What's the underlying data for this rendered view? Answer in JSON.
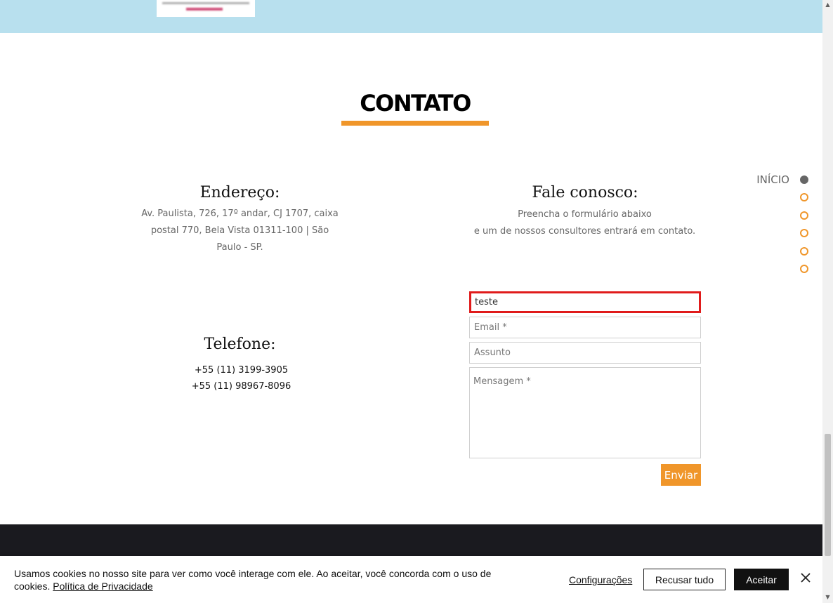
{
  "section": {
    "title": "CONTATO"
  },
  "address": {
    "heading": "Endereço:",
    "text": "Av. Paulista, 726, 17º andar, CJ 1707, caixa postal 770, Bela Vista 01311-100 | São Paulo - SP."
  },
  "phone": {
    "heading": "Telefone:",
    "numbers": [
      "+55 (11) 3199-3905",
      "+55 (11) 98967-8096"
    ]
  },
  "contact": {
    "heading": "Fale conosco:",
    "line1": "Preencha o formulário abaixo",
    "line2": "e um de nossos consultores entrará em contato."
  },
  "form": {
    "name_value": "teste",
    "email_placeholder": "Email *",
    "subject_placeholder": "Assunto",
    "message_placeholder": "Mensagem *",
    "submit_label": "Enviar"
  },
  "side_nav": {
    "active_label": "INÍCIO",
    "dot_count": 6,
    "active_index": 0
  },
  "cookie_banner": {
    "text": "Usamos cookies no nosso site para ver como você interage com ele. Ao aceitar, você concorda com o uso de cookies.",
    "policy_link": "Política de Privacidade",
    "settings_label": "Configurações",
    "reject_label": "Recusar tudo",
    "accept_label": "Aceitar",
    "close_icon": "close-icon"
  },
  "colors": {
    "accent": "#f0962a",
    "top_band": "#b8e0ee",
    "footer": "#1a1a1f",
    "focus_border": "#e01b1b"
  }
}
